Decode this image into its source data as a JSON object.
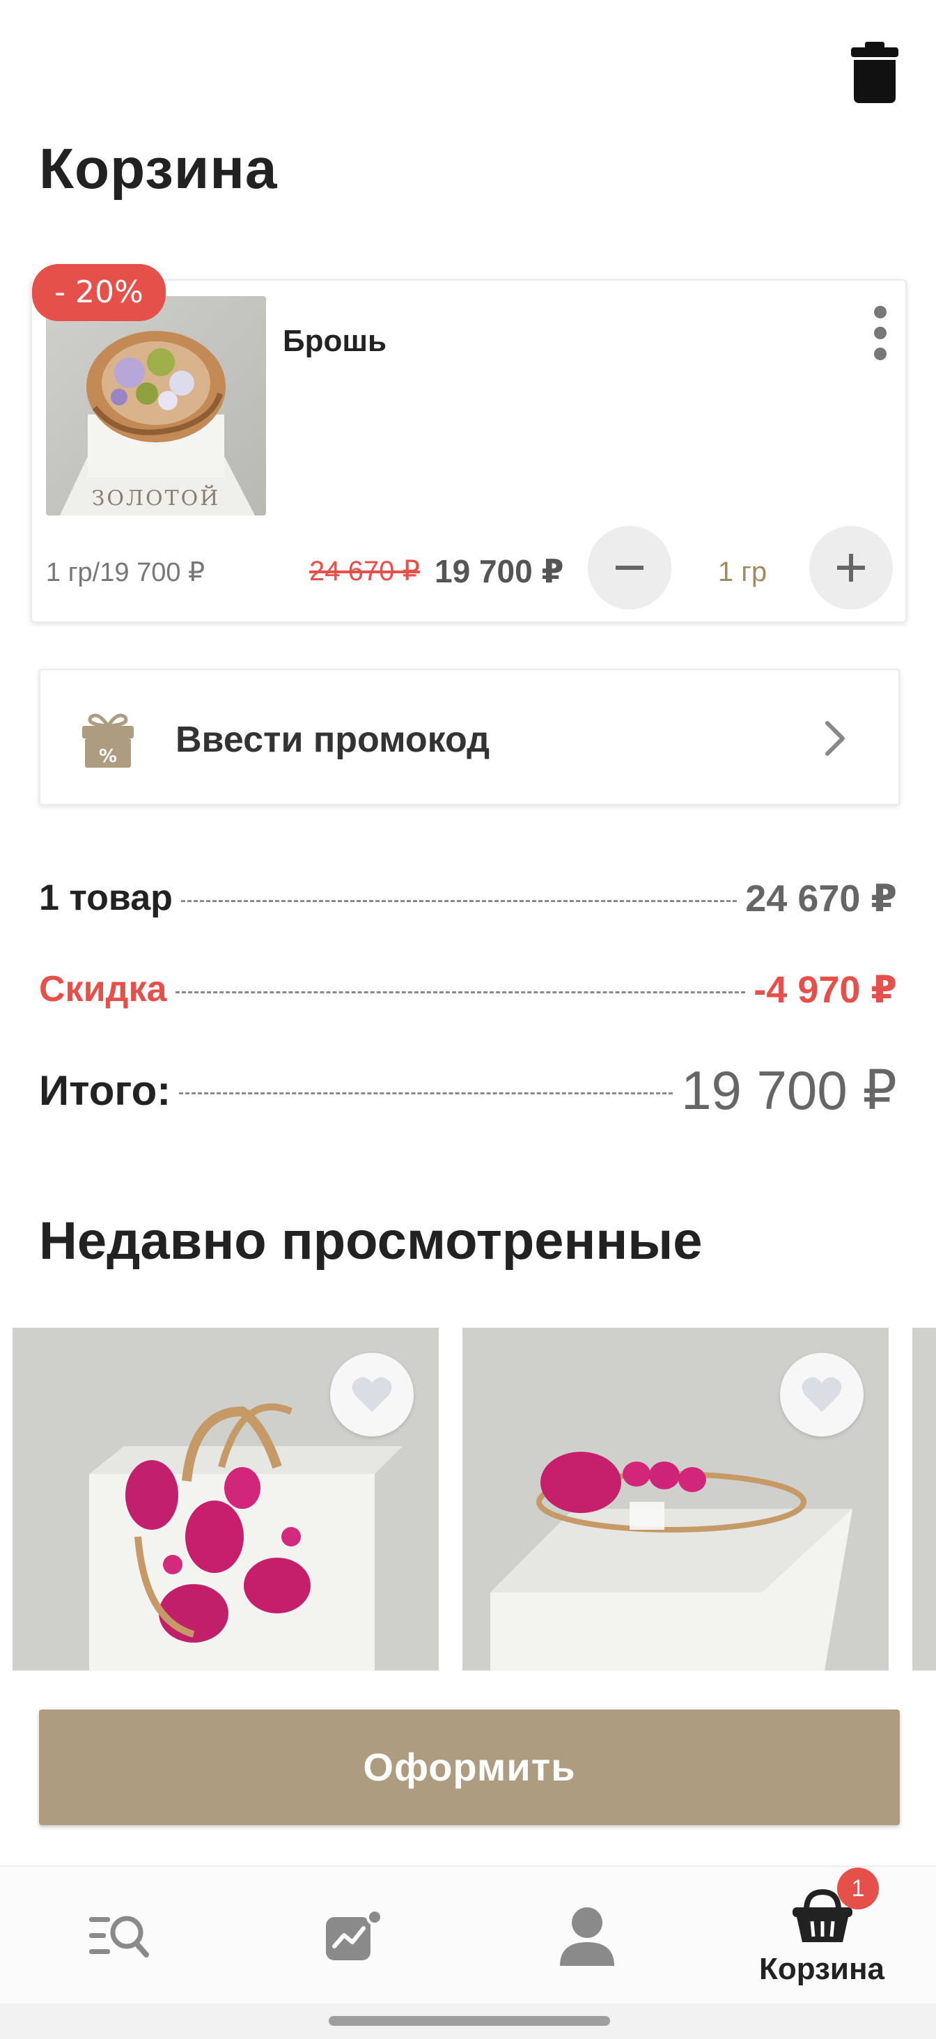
{
  "header": {
    "title": "Корзина",
    "trash_icon": "trash-icon"
  },
  "cart": {
    "items": [
      {
        "name": "Брошь",
        "discount_badge": "- 20%",
        "unit_price": "1 гр/19 700 ₽",
        "old_price": "24 670 ₽",
        "price": "19 700 ₽",
        "quantity": "1 гр",
        "image_caption": "ЗОЛОТОЙ"
      }
    ]
  },
  "promo": {
    "label": "Ввести промокод",
    "icon": "gift-percent-icon"
  },
  "summary": {
    "items_label": "1 товар",
    "items_value": "24 670 ₽",
    "discount_label": "Скидка",
    "discount_value": "-4 970 ₽",
    "total_label": "Итого:",
    "total_value": "19 700 ₽"
  },
  "recent": {
    "title": "Недавно просмотренные"
  },
  "checkout": {
    "label": "Оформить"
  },
  "nav": {
    "cart_label": "Корзина",
    "cart_badge": "1"
  },
  "colors": {
    "accent": "#ad9c7f",
    "discount_red": "#e5504a",
    "quantity_text": "#a08a64"
  }
}
